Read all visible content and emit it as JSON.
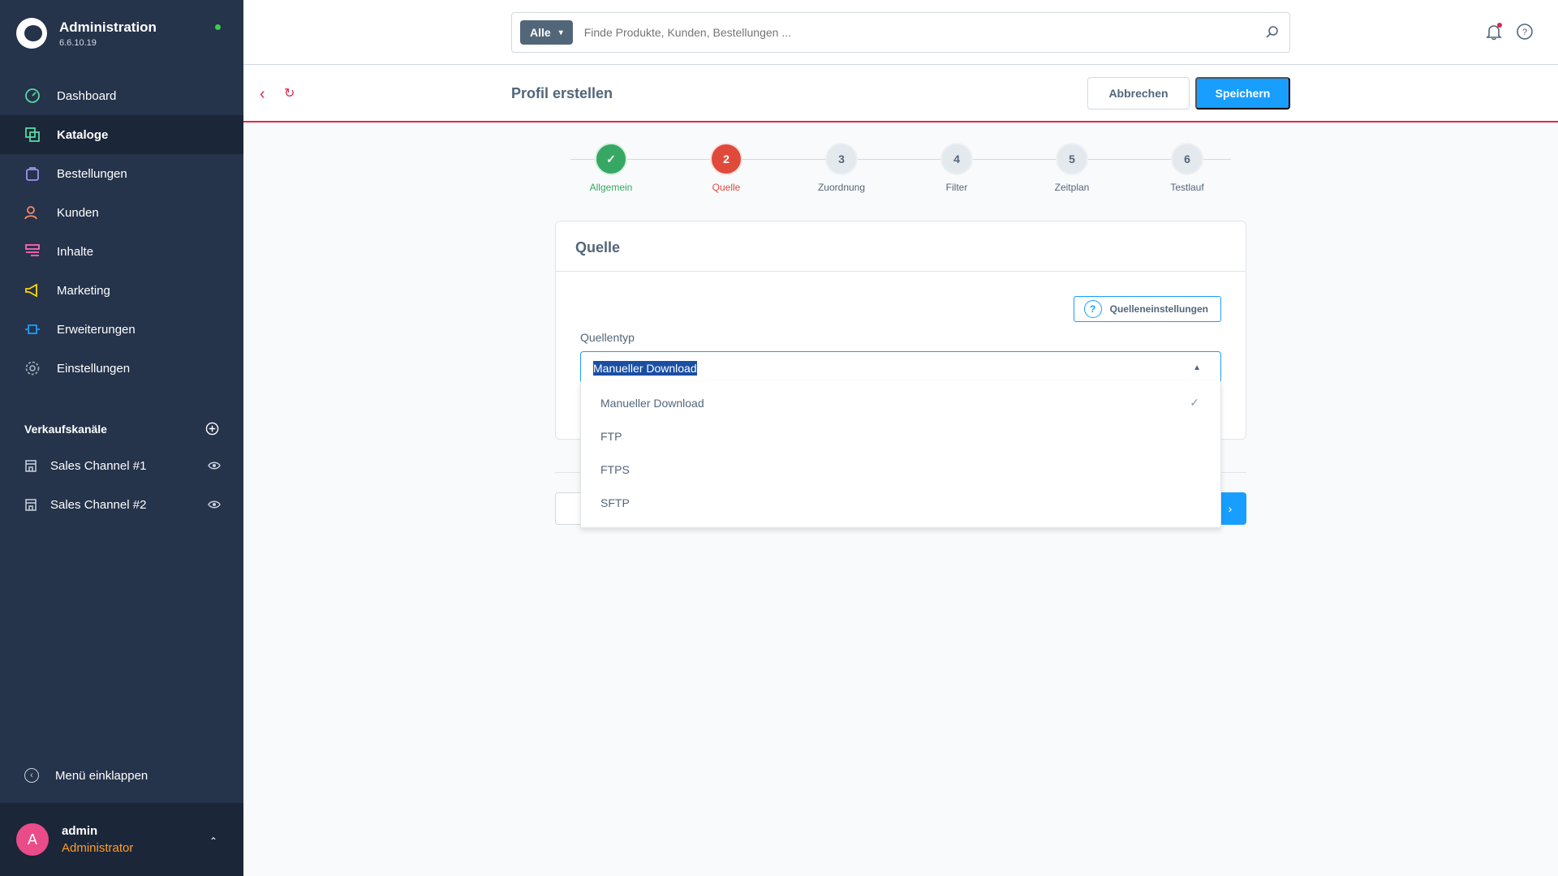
{
  "brand": {
    "title": "Administration",
    "version": "6.6.10.19"
  },
  "nav": [
    {
      "label": "Dashboard",
      "icon": "dashboard-icon",
      "color": "#57d9a3"
    },
    {
      "label": "Kataloge",
      "icon": "catalog-icon",
      "color": "#57d9a3"
    },
    {
      "label": "Bestellungen",
      "icon": "orders-icon",
      "color": "#a092f0"
    },
    {
      "label": "Kunden",
      "icon": "customers-icon",
      "color": "#f88962"
    },
    {
      "label": "Inhalte",
      "icon": "content-icon",
      "color": "#ff68b4"
    },
    {
      "label": "Marketing",
      "icon": "marketing-icon",
      "color": "#ffd700"
    },
    {
      "label": "Erweiterungen",
      "icon": "extensions-icon",
      "color": "#189eff"
    },
    {
      "label": "Einstellungen",
      "icon": "settings-icon",
      "color": "#9aa8b5"
    }
  ],
  "sales_channels": {
    "heading": "Verkaufskanäle",
    "items": [
      {
        "label": "Sales Channel #1"
      },
      {
        "label": "Sales Channel #2"
      }
    ]
  },
  "collapse_label": "Menü einklappen",
  "user": {
    "initial": "A",
    "name": "admin",
    "role": "Administrator"
  },
  "search": {
    "type": "Alle",
    "placeholder": "Finde Produkte, Kunden, Bestellungen ..."
  },
  "smartbar": {
    "title": "Profil erstellen",
    "cancel": "Abbrechen",
    "save": "Speichern"
  },
  "steps": [
    {
      "number": "✓",
      "label": "Allgemein",
      "state": "done"
    },
    {
      "number": "2",
      "label": "Quelle",
      "state": "current"
    },
    {
      "number": "3",
      "label": "Zuordnung",
      "state": "pending"
    },
    {
      "number": "4",
      "label": "Filter",
      "state": "pending"
    },
    {
      "number": "5",
      "label": "Zeitplan",
      "state": "pending"
    },
    {
      "number": "6",
      "label": "Testlauf",
      "state": "pending"
    }
  ],
  "card": {
    "title": "Quelle",
    "help_button": "Quelleneinstellungen",
    "field_label": "Quellentyp",
    "selected_value": "Manueller Download"
  },
  "dropdown": {
    "options": [
      {
        "label": "Manueller Download",
        "selected": true
      },
      {
        "label": "FTP",
        "selected": false
      },
      {
        "label": "FTPS",
        "selected": false
      },
      {
        "label": "SFTP",
        "selected": false
      }
    ]
  },
  "colors": {
    "sidebar": "#25334b",
    "accent": "#189eff",
    "danger": "#de294c",
    "success": "#37a863"
  }
}
